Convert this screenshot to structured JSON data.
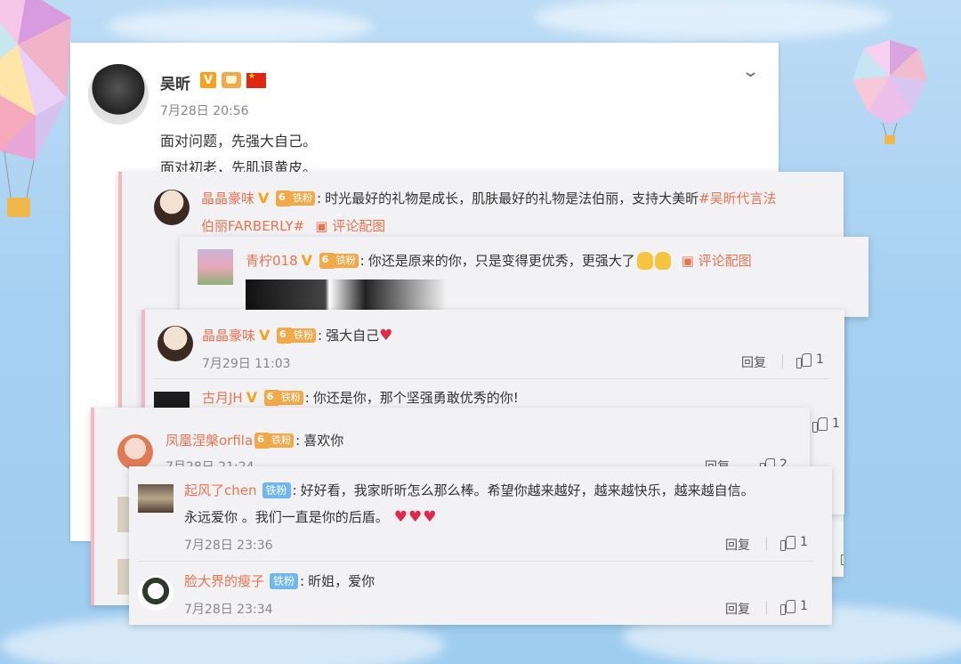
{
  "post": {
    "author": "吴昕",
    "time": "7月28日 20:56",
    "lines": [
      "面对问题，先强大自己。",
      "面对初老，先肌退黄皮。"
    ]
  },
  "icons": [
    "chevron-down-icon",
    "verified-v-icon",
    "crown-icon",
    "china-flag-icon",
    "image-icon",
    "thumbs-up-icon",
    "heart-emoji",
    "victory-hand-emoji"
  ],
  "colors": {
    "username": "#eb7350",
    "vip": "#f7a21a",
    "fan_badge": "#f1a94a",
    "fan_badge_blue": "#6fb7f0"
  },
  "comments": {
    "c1": {
      "user": "晶晶豪味",
      "fan": "铁粉",
      "text": "时光最好的礼物是成长，肌肤最好的礼物是法伯丽，支持大美昕",
      "tag": "#吴昕代言法",
      "tag2": "伯丽FARBERLY#",
      "img": "评论配图"
    },
    "c2": {
      "user": "青柠018",
      "fan": "铁粉",
      "text": "你还是原来的你，只是变得更优秀，更强大了",
      "img": "评论配图"
    },
    "c3": {
      "user": "晶晶豪味",
      "fan": "铁粉",
      "text": "强大自己",
      "time": "7月29日 11:03",
      "reply": "回复",
      "likes": "1"
    },
    "c4": {
      "user": "古月JH",
      "fan": "铁粉",
      "text": "你还是你，那个坚强勇敢优秀的你!",
      "likes": "1"
    },
    "c5": {
      "user": "凤凰涅槃orfila",
      "fan": "铁粉",
      "text": "喜欢你",
      "time": "7月28日 21:24",
      "reply": "回复",
      "likes": "2"
    },
    "c6": {
      "user": "起风了chen",
      "fan": "铁粉",
      "text": "好好看，我家昕昕怎么那么棒。希望你越来越好，越来越快乐，越来越自信。",
      "text2": "永远爱你 。我们一直是你的后盾。",
      "time": "7月28日 23:36",
      "reply": "回复",
      "likes": "1"
    },
    "c7": {
      "user": "脸大界的瘦子",
      "fan": "铁粉",
      "text": "昕姐，爱你",
      "time": "7月28日 23:34",
      "reply": "回复",
      "likes": "1"
    }
  },
  "side_likes": [
    "6",
    "6"
  ]
}
